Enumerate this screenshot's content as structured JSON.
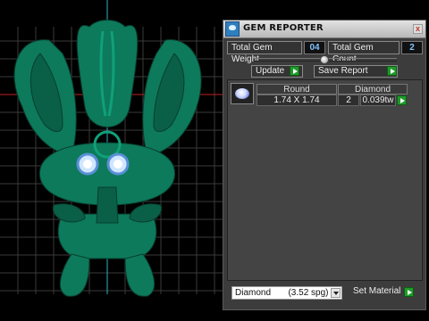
{
  "panel": {
    "title": "GEM REPORTER",
    "close_label": "x",
    "total_weight_label": "Total Gem Weight",
    "total_weight_value": "04",
    "total_count_label": "Total Gem Count",
    "total_count_value": "2",
    "update_label": "Update",
    "save_label": "Save Report",
    "table": {
      "headers": [
        "Round",
        "Diamond"
      ],
      "rows": [
        {
          "size": "1.74 X 1.74",
          "count": "2",
          "weight": "0.039tw"
        }
      ]
    },
    "material_select": "Diamond       (3.52 spg)",
    "set_material_label": "Set Material"
  },
  "colors": {
    "model": "#0d7a5b",
    "panel": "#3c3c3c",
    "accent_green": "#1f9b2a",
    "value_blue": "#7fc3ff"
  },
  "icons": [
    "gem-reporter-app-icon",
    "close-icon",
    "play-arrow-icon",
    "diamond-gem-icon",
    "dropdown-arrow-icon"
  ]
}
